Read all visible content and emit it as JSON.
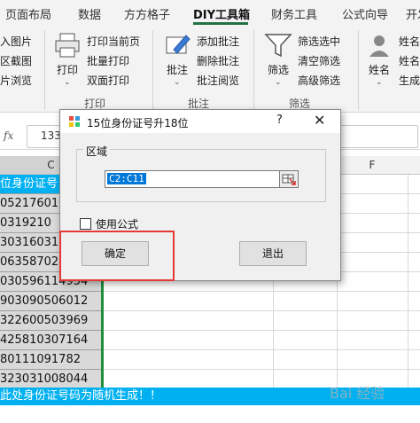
{
  "tabs": [
    "页面布局",
    "数据",
    "方方格子",
    "DIY工具箱",
    "财务工具",
    "公式向导",
    "开发"
  ],
  "active_tab": "DIY工具箱",
  "ribbon": {
    "left_partial": [
      "入图片",
      "区截图",
      "片浏览"
    ],
    "print_big": "打印",
    "print_items": [
      "打印当前页",
      "批量打印",
      "双面打印"
    ],
    "print_group": "打印",
    "comment_big": "批注",
    "comment_items": [
      "添加批注",
      "删除批注",
      "批注阅览"
    ],
    "comment_group": "批注",
    "filter_big": "筛选",
    "filter_items": [
      "筛选选中",
      "清空筛选",
      "高级筛选"
    ],
    "filter_group": "筛选",
    "name_big": "姓名",
    "name_items": [
      "姓名",
      "姓名",
      "生成"
    ]
  },
  "formula_bar": {
    "fx": "fx",
    "value": "133"
  },
  "columns": {
    "c": "C",
    "f": "F"
  },
  "cells": [
    "位身份证号",
    "05217601",
    "0319210",
    "30316031",
    "063587020",
    "030596114954",
    "903090506012",
    "322600503969",
    "425810307164",
    "80111091782",
    "323031008044"
  ],
  "footer_text": "此处身份证号码为随机生成！！",
  "dialog": {
    "title": "15位身份证号升18位",
    "help": "?",
    "close": "✕",
    "group_label": "区域",
    "range_value": "C2:C11",
    "checkbox_label": "使用公式",
    "ok": "确定",
    "exit": "退出"
  },
  "watermark": "Bai 经验"
}
